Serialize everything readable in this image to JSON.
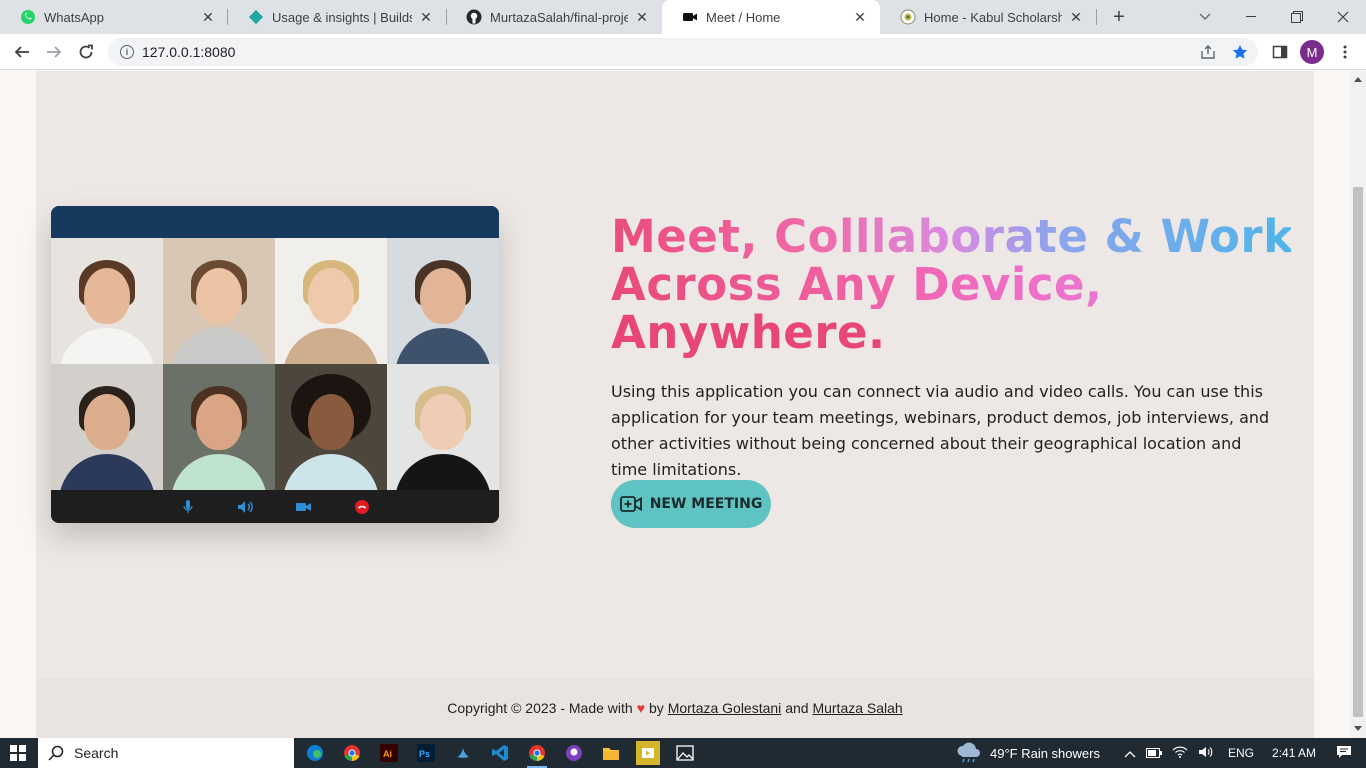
{
  "browser": {
    "tabs": [
      {
        "title": "WhatsApp",
        "icon": "whatsapp-icon",
        "active": false
      },
      {
        "title": "Usage & insights | Builds | m",
        "icon": "netlify-icon",
        "active": false
      },
      {
        "title": "MurtazaSalah/final-project: f",
        "icon": "github-icon",
        "active": false
      },
      {
        "title": "Meet / Home",
        "icon": "video-camera-icon",
        "active": true
      },
      {
        "title": "Home - Kabul Scholarship",
        "icon": "scholarship-icon",
        "active": false
      }
    ],
    "url": "127.0.0.1:8080",
    "profile_initial": "M"
  },
  "hero": {
    "headline_line1_a": "Meet, Colllaborate & Work",
    "headline_line2": "Across Any Device,",
    "headline_line3": "Anywhere.",
    "description": "Using this application you can connect via audio and video calls. You can use this application for your team meetings, webinars, product demos, job interviews, and other activities without being concerned about their geographical location and time limitations.",
    "cta_label": "NEW MEETING"
  },
  "footer": {
    "prefix": "Copyright © 2023 - Made with",
    "by": "by",
    "author1": "Mortaza Golestani",
    "and": "and",
    "author2": "Murtaza Salah"
  },
  "taskbar": {
    "search_label": "Search",
    "weather": "49°F  Rain showers",
    "language": "ENG",
    "time": "2:41 AM"
  },
  "colors": {
    "accent_teal": "#5fc3c3",
    "headline_pink": "#e8457a",
    "headline_blue": "#4fb5ea",
    "video_topbar": "#163a5d"
  }
}
